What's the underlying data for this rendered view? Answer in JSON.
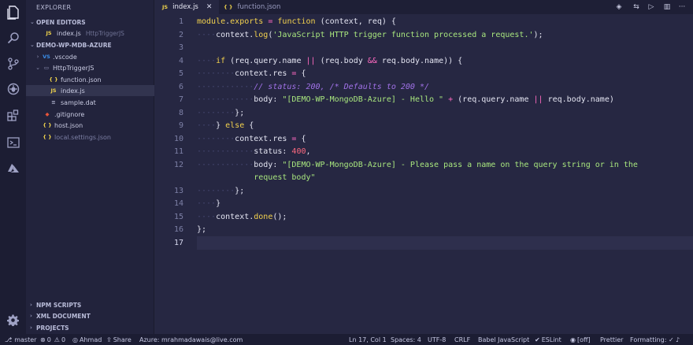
{
  "activity_bar": {
    "icons": [
      "files-icon",
      "search-icon",
      "source-control-icon",
      "debug-icon",
      "extensions-icon",
      "terminal-icon",
      "azure-icon",
      "settings-icon"
    ]
  },
  "sidebar": {
    "title": "EXPLORER",
    "open_editors_label": "OPEN EDITORS",
    "open_editor": {
      "badge": "JS",
      "name": "index.js",
      "path": "HttpTriggerJS"
    },
    "project_label": "DEMO-WP-MDB-AZURE",
    "tree": [
      {
        "badge": "VS",
        "name": ".vscode",
        "type": "folder-collapsed"
      },
      {
        "badge": "",
        "name": "HttpTriggerJS",
        "type": "folder-open"
      },
      {
        "badge": "{ }",
        "name": "function.json",
        "type": "json"
      },
      {
        "badge": "JS",
        "name": "index.js",
        "type": "js",
        "selected": true
      },
      {
        "badge": "≡",
        "name": "sample.dat",
        "type": "dat"
      },
      {
        "badge": "◆",
        "name": ".gitignore",
        "type": "git"
      },
      {
        "badge": "{ }",
        "name": "host.json",
        "type": "json"
      },
      {
        "badge": "{ }",
        "name": "local.settings.json",
        "type": "json-ghost"
      }
    ],
    "bottom_sections": [
      "NPM SCRIPTS",
      "XML DOCUMENT",
      "PROJECTS"
    ]
  },
  "tabs": [
    {
      "badge": "JS",
      "label": "index.js",
      "active": true,
      "close": "✕"
    },
    {
      "badge": "{ }",
      "label": "function.json",
      "active": false
    }
  ],
  "editor": {
    "current_line": 17,
    "line_numbers": [
      "1",
      "2",
      "3",
      "4",
      "5",
      "6",
      "7",
      "8",
      "9",
      "10",
      "11",
      "12",
      "",
      "13",
      "14",
      "15",
      "16",
      "17"
    ],
    "code": [
      [
        [
          "k",
          "module"
        ],
        [
          "p",
          "."
        ],
        [
          "k",
          "exports"
        ],
        [
          "p",
          " "
        ],
        [
          "op",
          "="
        ],
        [
          "p",
          " "
        ],
        [
          "k",
          "function"
        ],
        [
          "p",
          " (context, req) {"
        ]
      ],
      [
        [
          "ws",
          "····"
        ],
        [
          "p",
          "context."
        ],
        [
          "k",
          "log"
        ],
        [
          "p",
          "("
        ],
        [
          "s",
          "'JavaScript HTTP trigger function processed a request.'"
        ],
        [
          "p",
          ");"
        ]
      ],
      [],
      [
        [
          "ws",
          "····"
        ],
        [
          "k",
          "if"
        ],
        [
          "p",
          " (req.query.name "
        ],
        [
          "op",
          "||"
        ],
        [
          "p",
          " (req.body "
        ],
        [
          "op",
          "&&"
        ],
        [
          "p",
          " req.body.name)) {"
        ]
      ],
      [
        [
          "ws",
          "········"
        ],
        [
          "p",
          "context.res "
        ],
        [
          "op",
          "="
        ],
        [
          "p",
          " {"
        ]
      ],
      [
        [
          "ws",
          "············"
        ],
        [
          "c",
          "// status: 200, /* Defaults to 200 */"
        ]
      ],
      [
        [
          "ws",
          "············"
        ],
        [
          "p",
          "body: "
        ],
        [
          "s",
          "\"[DEMO-WP-MongoDB-Azure] - Hello \""
        ],
        [
          "p",
          " "
        ],
        [
          "op",
          "+"
        ],
        [
          "p",
          " (req.query.name "
        ],
        [
          "op",
          "||"
        ],
        [
          "p",
          " req.body.name)"
        ]
      ],
      [
        [
          "ws",
          "········"
        ],
        [
          "p",
          "};"
        ]
      ],
      [
        [
          "ws",
          "····"
        ],
        [
          "p",
          "} "
        ],
        [
          "k",
          "else"
        ],
        [
          "p",
          " {"
        ]
      ],
      [
        [
          "ws",
          "········"
        ],
        [
          "p",
          "context.res "
        ],
        [
          "op",
          "="
        ],
        [
          "p",
          " {"
        ]
      ],
      [
        [
          "ws",
          "············"
        ],
        [
          "p",
          "status: "
        ],
        [
          "n",
          "400"
        ],
        [
          "p",
          ","
        ]
      ],
      [
        [
          "ws",
          "············"
        ],
        [
          "p",
          "body: "
        ],
        [
          "s",
          "\"[DEMO-WP-MongoDB-Azure] - Please pass a name on the query string or in the"
        ]
      ],
      [
        [
          "p",
          "            "
        ],
        [
          "s",
          "request body\""
        ]
      ],
      [
        [
          "ws",
          "········"
        ],
        [
          "p",
          "};"
        ]
      ],
      [
        [
          "ws",
          "····"
        ],
        [
          "p",
          "}"
        ]
      ],
      [
        [
          "ws",
          "····"
        ],
        [
          "p",
          "context."
        ],
        [
          "k",
          "done"
        ],
        [
          "p",
          "();"
        ]
      ],
      [
        [
          "p",
          "};"
        ]
      ],
      []
    ]
  },
  "status_bar": {
    "branch": "master",
    "errors": "0",
    "warnings": "0",
    "user": "Ahmad",
    "share": "Share",
    "azure": "Azure: mrahmadawais@live.com",
    "position": "Ln 17, Col 1",
    "spaces": "Spaces: 4",
    "encoding": "UTF-8",
    "eol": "CRLF",
    "language": "Babel JavaScript",
    "eslint": "ESLint",
    "off": "[off]",
    "prettier": "Prettier",
    "formatting": "Formatting: ✓"
  }
}
